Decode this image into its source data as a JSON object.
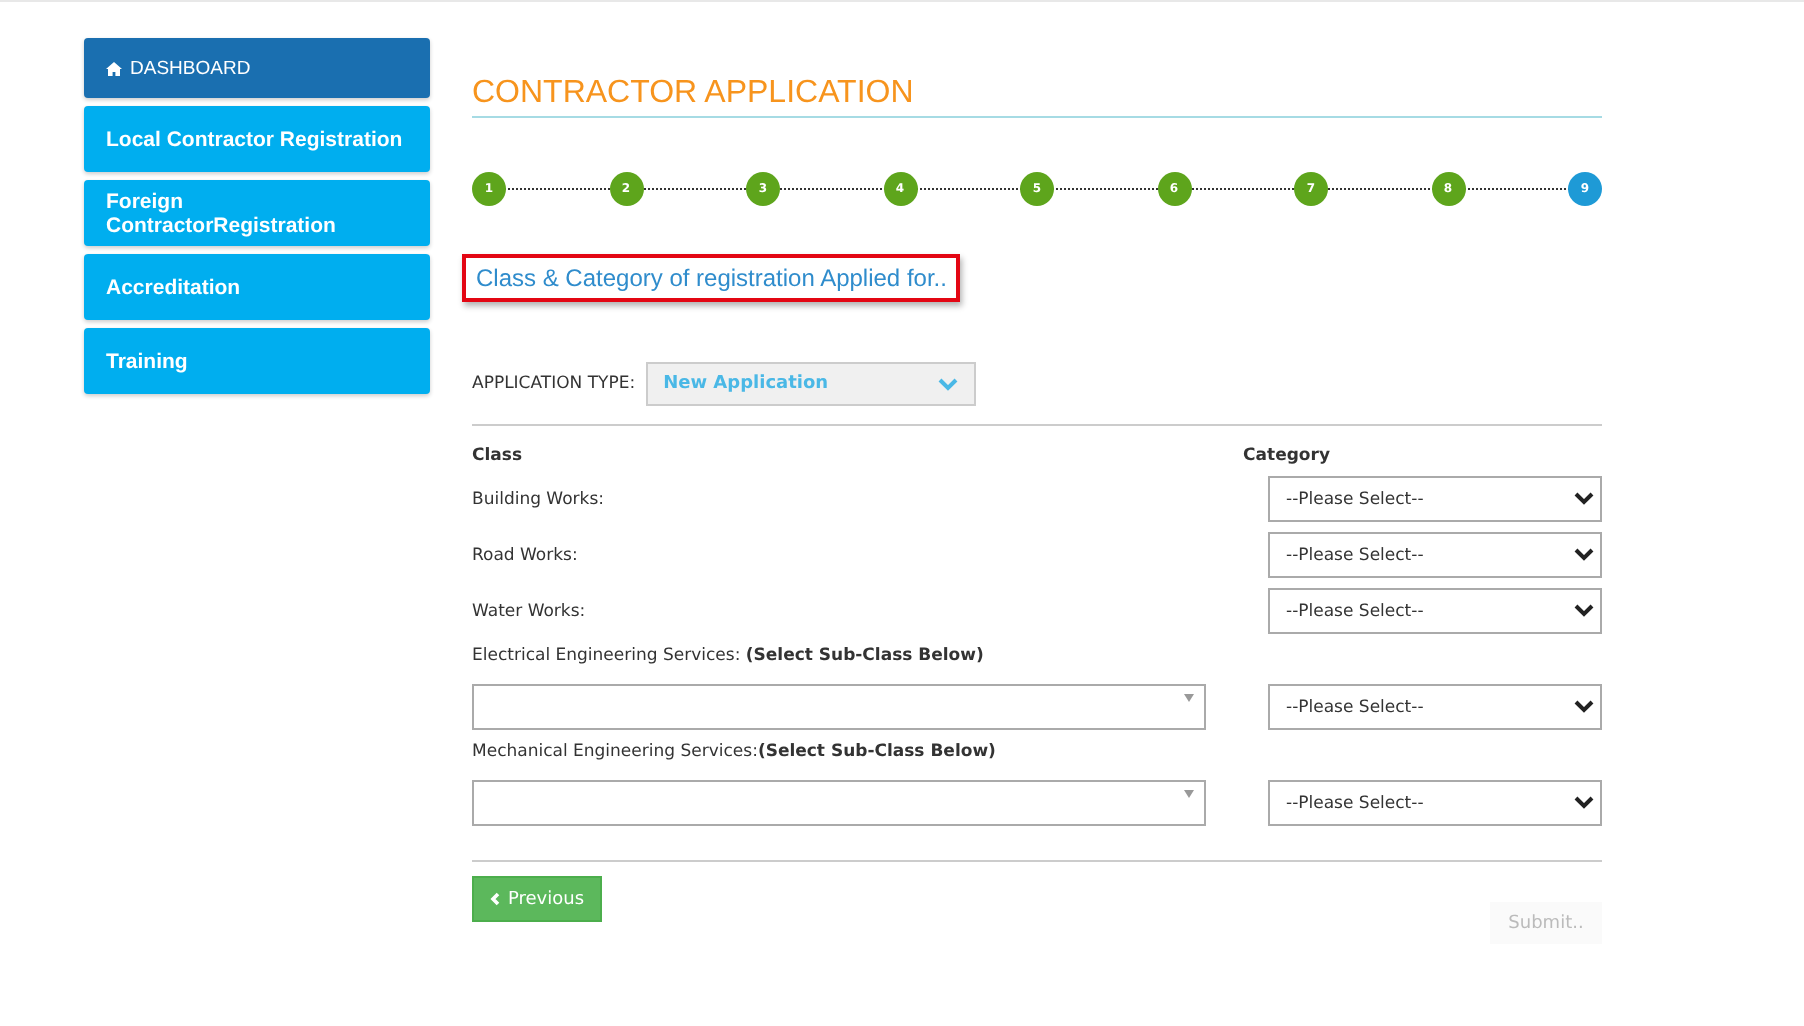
{
  "sidebar": {
    "items": [
      {
        "label": "DASHBOARD",
        "kind": "home",
        "selected": true
      },
      {
        "label": "Local Contractor Registration",
        "kind": "link",
        "selected": false
      },
      {
        "label": "Foreign ContractorRegistration",
        "kind": "link",
        "selected": false
      },
      {
        "label": "Accreditation",
        "kind": "link",
        "selected": false
      },
      {
        "label": "Training",
        "kind": "link",
        "selected": false
      }
    ]
  },
  "title": "CONTRACTOR APPLICATION",
  "steps": [
    {
      "label": "1",
      "selected": false
    },
    {
      "label": "2",
      "selected": false
    },
    {
      "label": "3",
      "selected": false
    },
    {
      "label": "4",
      "selected": false
    },
    {
      "label": "5",
      "selected": false
    },
    {
      "label": "6",
      "selected": false
    },
    {
      "label": "7",
      "selected": false
    },
    {
      "label": "8",
      "selected": false
    },
    {
      "label": "9",
      "selected": true
    }
  ],
  "section_heading": "Class & Category of registration Applied for..",
  "application_type": {
    "label": "APPLICATION TYPE:",
    "value": "New Application"
  },
  "columns": [
    "Class",
    "Category"
  ],
  "classes": [
    {
      "kind": "simple",
      "label": "Building Works:",
      "category": "--Please Select--"
    },
    {
      "kind": "simple",
      "label": "Road Works:",
      "category": "--Please Select--"
    },
    {
      "kind": "simple",
      "label": "Water Works:",
      "category": "--Please Select--"
    },
    {
      "kind": "subclass",
      "label": "Electrical Engineering Services: **(Select Sub-Class Below)**",
      "category": "--Please Select--"
    },
    {
      "kind": "subclass",
      "label": "Mechanical Engineering Services:**(Select Sub-Class Below)**",
      "category": "--Please Select--"
    }
  ],
  "buttons": {
    "previous": "Previous",
    "submit": "Submit.."
  }
}
